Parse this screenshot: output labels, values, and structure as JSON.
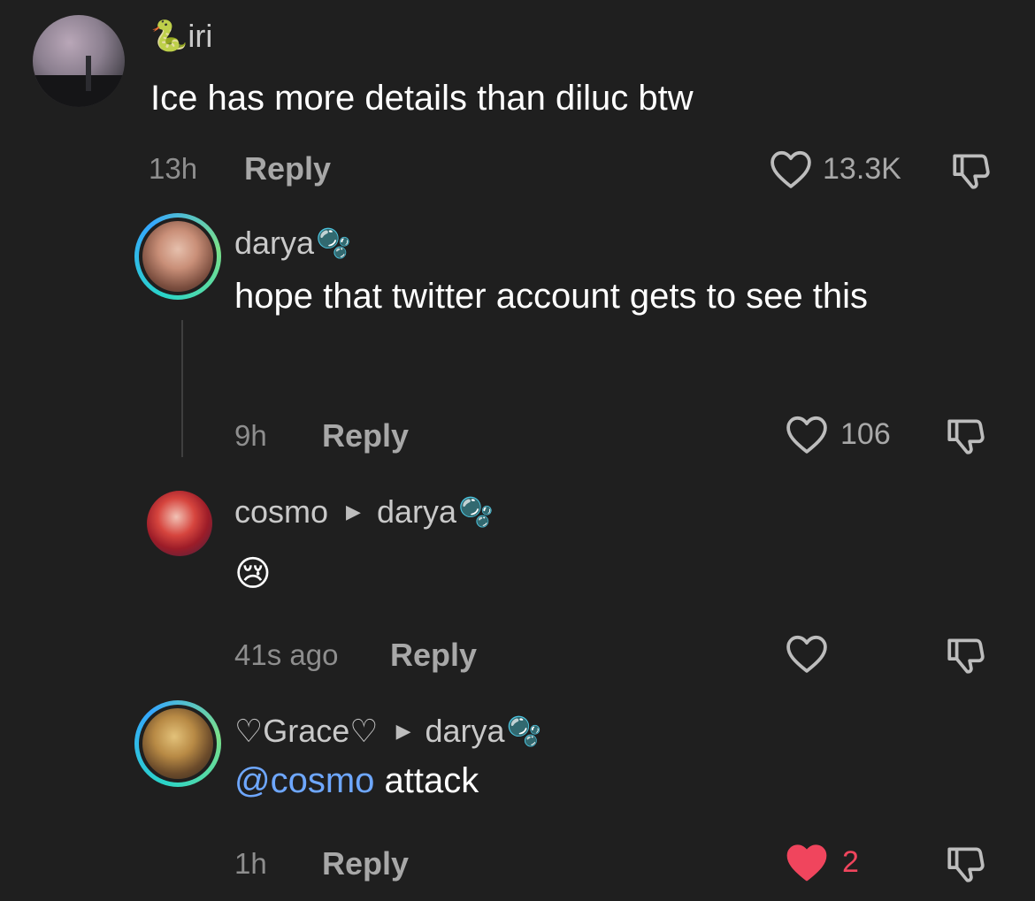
{
  "comments": [
    {
      "username": "iri",
      "username_prefix_emoji": "🐍",
      "text": "Ice has more details than diluc btw",
      "time": "13h",
      "reply_label": "Reply",
      "likes": "13.3K",
      "liked": false
    },
    {
      "username": "darya",
      "username_suffix_emoji": "🫧",
      "text": "hope that twitter account gets to see this",
      "time": "9h",
      "reply_label": "Reply",
      "likes": "106",
      "liked": false
    },
    {
      "username": "cosmo",
      "reply_to": "darya",
      "reply_to_suffix_emoji": "🫧",
      "text": "😢",
      "time": "41s ago",
      "reply_label": "Reply",
      "likes": "",
      "liked": false
    },
    {
      "username": "♡Grace♡",
      "reply_to": "darya",
      "reply_to_suffix_emoji": "🫧",
      "mention": "@cosmo",
      "text": " attack",
      "time": "1h",
      "reply_label": "Reply",
      "likes": "2",
      "liked": true
    }
  ],
  "colors": {
    "background": "#1f1f1f",
    "liked_heart": "#f0455d",
    "mention": "#6ea7ff",
    "story_ring": "#2ad4c8"
  },
  "icons": [
    "heart-outline-icon",
    "heart-filled-icon",
    "dislike-icon",
    "play-arrow-icon"
  ]
}
